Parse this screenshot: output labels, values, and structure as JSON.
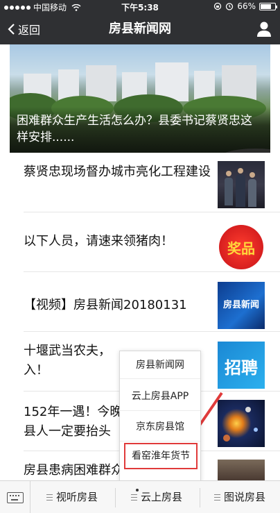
{
  "status_bar": {
    "carrier": "中国移动",
    "time": "下午5:38",
    "battery": "66%"
  },
  "nav": {
    "back_label": "返回",
    "title": "房县新闻网"
  },
  "hero": {
    "caption": "困难群众生产生活怎么办？县委书记蔡贤忠这样安排......"
  },
  "news": [
    {
      "title": "蔡贤忠现场督办城市亮化工程建设"
    },
    {
      "title": "以下人员，请速来领猪肉！",
      "thumb_text": "奖品"
    },
    {
      "title": "【视频】房县新闻20180131",
      "thumb_text": "房县新闻"
    },
    {
      "title": "十堰武当农夫，入！",
      "thumb_text": "招聘"
    },
    {
      "title": "152年一遇！今晚县人一定要抬头"
    },
    {
      "title": "房县患病困难群众：盼望卫生"
    }
  ],
  "popup": {
    "items": [
      "房县新闻网",
      "云上房县APP",
      "京东房县馆",
      "看窑淮年货节"
    ]
  },
  "bottom_menu": {
    "tabs": [
      "视听房县",
      "云上房县",
      "图说房县"
    ]
  },
  "colors": {
    "bar": "#2f3033",
    "highlight": "#e03a3a"
  }
}
